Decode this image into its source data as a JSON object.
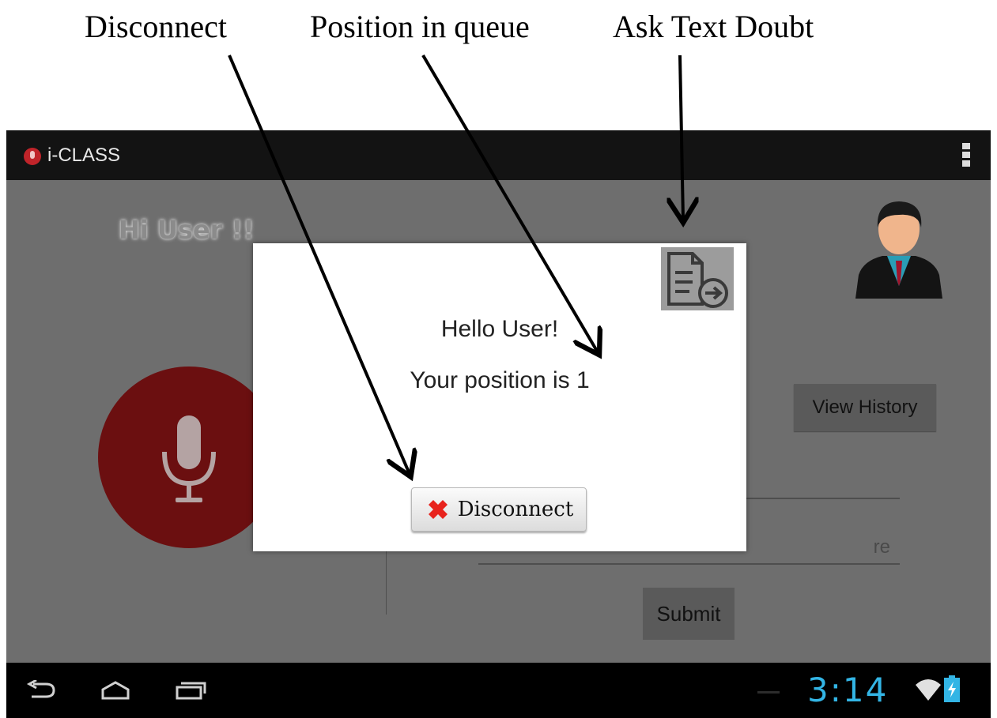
{
  "captions": {
    "disconnect": "Disconnect",
    "position": "Position in queue",
    "ask_doubt": "Ask Text Doubt"
  },
  "app": {
    "title": "i-CLASS"
  },
  "main": {
    "greeting": "Hi User !!",
    "view_history": "View History",
    "doubt_placeholder_fragment": "re",
    "submit": "Submit"
  },
  "dialog": {
    "hello": "Hello User!",
    "position": "Your position is 1",
    "disconnect": "Disconnect"
  },
  "status": {
    "clock": "3:14"
  },
  "colors": {
    "accent": "#33b5e5",
    "mic": "#6b0f10",
    "brand": "#c0242a"
  },
  "icons": [
    "mic-icon",
    "document-arrow-icon",
    "close-x-icon",
    "back-icon",
    "home-icon",
    "recent-apps-icon",
    "wifi-icon",
    "battery-icon",
    "overflow-menu-icon",
    "user-avatar-icon"
  ]
}
